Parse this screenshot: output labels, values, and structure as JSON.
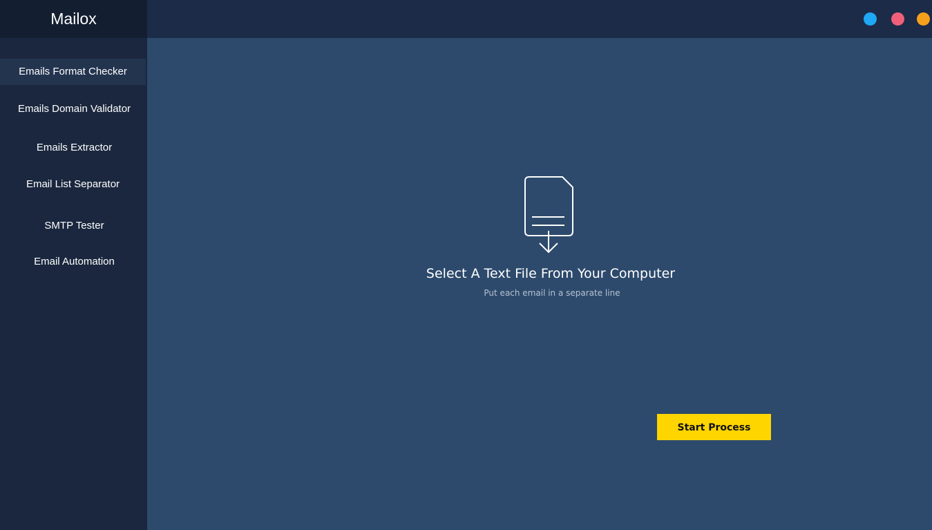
{
  "app": {
    "title": "Mailox"
  },
  "sidebar": {
    "items": [
      {
        "label": "Emails Format Checker",
        "active": true
      },
      {
        "label": "Emails Domain Validator",
        "active": false
      },
      {
        "label": "Emails Extractor",
        "active": false
      },
      {
        "label": "Email List Separator",
        "active": false
      },
      {
        "label": "SMTP Tester",
        "active": false
      },
      {
        "label": "Email Automation",
        "active": false
      }
    ]
  },
  "window_controls": [
    {
      "name": "blue-dot",
      "color": "#1ea8f5"
    },
    {
      "name": "red-dot",
      "color": "#f0607a"
    },
    {
      "name": "orange-dot",
      "color": "#f5a11c"
    }
  ],
  "main": {
    "icon": "file-download-icon",
    "title": "Select A Text File From Your Computer",
    "hint": "Put each email in a separate line",
    "start_button": "Start Process"
  },
  "colors": {
    "sidebar_bg": "#1a273e",
    "brand_bg": "#131f31",
    "topbar_bg": "#1b2b48",
    "main_bg": "#2d4a6c",
    "active_item_bg": "#23344f",
    "accent": "#ffd500"
  }
}
